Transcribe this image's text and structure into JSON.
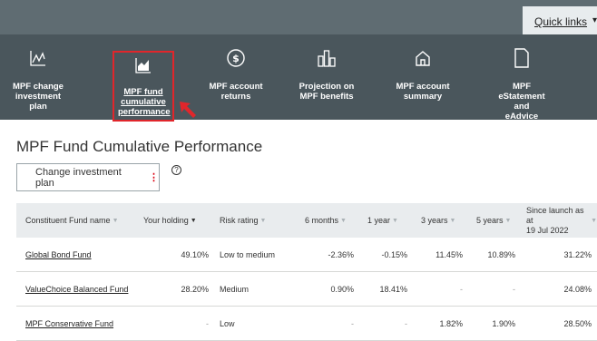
{
  "topbar": {
    "quick_links": "Quick links"
  },
  "nav": {
    "items": [
      {
        "label1": "MPF change",
        "label2": "investment plan",
        "label3": ""
      },
      {
        "label1": "MPF fund",
        "label2": "cumulative",
        "label3": "performance"
      },
      {
        "label1": "MPF account",
        "label2": "returns",
        "label3": ""
      },
      {
        "label1": "Projection on",
        "label2": "MPF benefits",
        "label3": ""
      },
      {
        "label1": "MPF account",
        "label2": "summary",
        "label3": ""
      },
      {
        "label1": "MPF",
        "label2": "eStatement and",
        "label3": "eAdvice"
      }
    ]
  },
  "page": {
    "title": "MPF Fund Cumulative Performance",
    "change_plan": "Change investment plan"
  },
  "table": {
    "headers": {
      "fund": "Constituent Fund name",
      "holding": "Your holding",
      "risk": "Risk rating",
      "m6": "6 months",
      "y1": "1 year",
      "y3": "3 years",
      "y5": "5 years",
      "since1": "Since launch as at",
      "since2": "19 Jul 2022"
    },
    "rows": [
      {
        "fund": "Global Bond Fund",
        "holding": "49.10%",
        "risk": "Low to medium",
        "m6": "-2.36%",
        "y1": "-0.15%",
        "y3": "11.45%",
        "y5": "10.89%",
        "since": "31.22%"
      },
      {
        "fund": "ValueChoice Balanced Fund",
        "holding": "28.20%",
        "risk": "Medium",
        "m6": "0.90%",
        "y1": "18.41%",
        "y3": "-",
        "y5": "-",
        "since": "24.08%"
      },
      {
        "fund": "MPF Conservative Fund",
        "holding": "-",
        "risk": "Low",
        "m6": "-",
        "y1": "-",
        "y3": "1.82%",
        "y5": "1.90%",
        "since": "28.50%"
      }
    ]
  }
}
